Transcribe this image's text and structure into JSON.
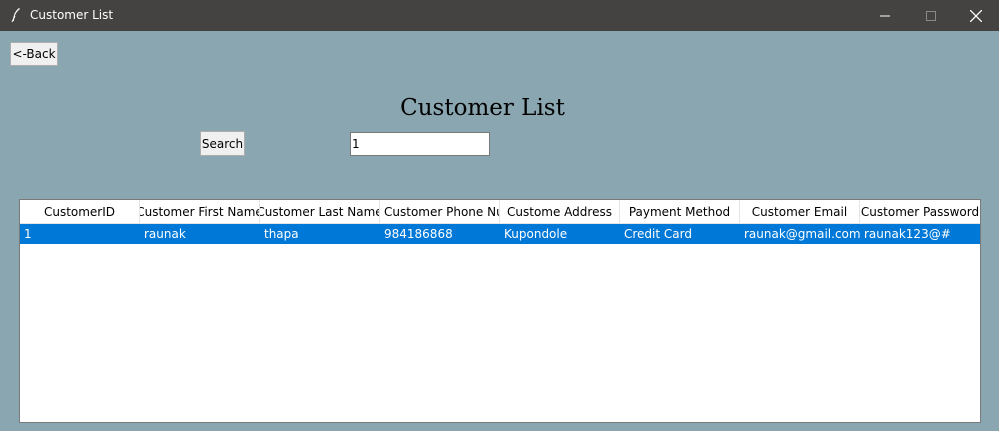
{
  "window": {
    "title": "Customer List",
    "titlebar_color": "#454341"
  },
  "toolbar": {
    "back_label": "<-Back",
    "search_label": "Search"
  },
  "page": {
    "heading": "Customer List",
    "background_color": "#8aa6b0"
  },
  "search": {
    "value": "1"
  },
  "table": {
    "columns": [
      "CustomerID",
      "Customer First Name",
      "Customer Last Name",
      "Customer Phone Number",
      "Custome Address",
      "Payment Method",
      "Customer Email",
      "Customer Password"
    ],
    "rows": [
      {
        "selected": true,
        "cells": [
          "1",
          "raunak",
          "thapa",
          "984186868",
          "Kupondole",
          "Credit Card",
          "raunak@gmail.com",
          "raunak123@#"
        ]
      }
    ],
    "selection_color": "#0078d7"
  },
  "icons": {
    "app": "feather-icon",
    "minimize": "minimize-icon",
    "maximize": "maximize-icon",
    "close": "close-icon"
  }
}
